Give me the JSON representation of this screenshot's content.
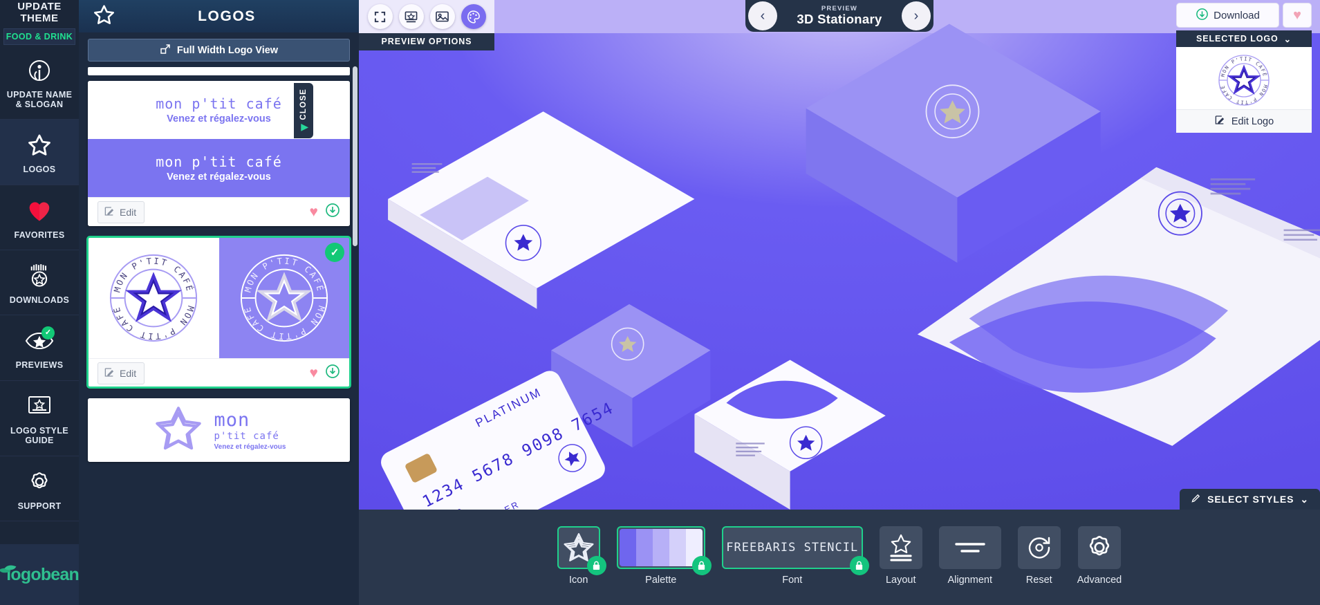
{
  "rail": {
    "top_title": "UPDATE THEME",
    "theme_value": "FOOD & DRINK",
    "items": [
      {
        "label": "UPDATE NAME & SLOGAN",
        "icon": "info-badge-icon"
      },
      {
        "label": "LOGOS",
        "icon": "star-icon"
      },
      {
        "label": "FAVORITES",
        "icon": "heart-icon"
      },
      {
        "label": "DOWNLOADS",
        "icon": "download-star-icon"
      },
      {
        "label": "PREVIEWS",
        "icon": "eye-star-icon"
      },
      {
        "label": "LOGO STYLE GUIDE",
        "icon": "style-guide-icon"
      },
      {
        "label": "SUPPORT",
        "icon": "gear-icon"
      }
    ],
    "brand": "logobean"
  },
  "logos_panel": {
    "title": "LOGOS",
    "full_width_button": "Full Width Logo View",
    "edit_label": "Edit",
    "cards": [
      {
        "type": "wordmark",
        "name": "mon p'tit café",
        "slogan": "Venez et régalez-vous",
        "selected": false
      },
      {
        "type": "emblem",
        "name": "MON P'TIT CAFÉ",
        "selected": true
      },
      {
        "type": "combo",
        "name": "mon",
        "sub": "p'tit café",
        "slogan": "Venez et régalez-vous",
        "selected": false
      }
    ]
  },
  "close_tab": {
    "label": "CLOSE"
  },
  "preview_options": {
    "label": "PREVIEW OPTIONS",
    "buttons": [
      {
        "name": "fullscreen-icon",
        "active": false
      },
      {
        "name": "presentation-icon",
        "active": false
      },
      {
        "name": "image-icon",
        "active": false
      },
      {
        "name": "palette-icon",
        "active": true
      }
    ]
  },
  "preview_nav": {
    "eyebrow": "PREVIEW",
    "title": "3D Stationary",
    "prev": "‹",
    "next": "›"
  },
  "right_panel": {
    "download_label": "Download",
    "favorite_icon": "heart-icon",
    "selected_logo_label": "SELECTED LOGO",
    "edit_logo_label": "Edit Logo"
  },
  "select_styles": {
    "label": "SELECT STYLES"
  },
  "bottom_bar": {
    "tools": [
      {
        "key": "icon",
        "caption": "Icon",
        "locked": true,
        "kind": "star"
      },
      {
        "key": "palette",
        "caption": "Palette",
        "locked": true,
        "kind": "swatches",
        "colors": [
          "#6f66ee",
          "#9b92f4",
          "#b7b0f7",
          "#d4d0fa",
          "#efeeff"
        ]
      },
      {
        "key": "font",
        "caption": "Font",
        "locked": true,
        "kind": "font",
        "font_sample": "FREEBARIS STENCIL"
      },
      {
        "key": "layout",
        "caption": "Layout",
        "locked": false,
        "kind": "layout"
      },
      {
        "key": "alignment",
        "caption": "Alignment",
        "locked": false,
        "kind": "align"
      },
      {
        "key": "reset",
        "caption": "Reset",
        "locked": false,
        "kind": "reset"
      },
      {
        "key": "advanced",
        "caption": "Advanced",
        "locked": false,
        "kind": "gear"
      }
    ]
  },
  "emblem": {
    "top_text": "MON P'TIT CAFÉ",
    "bottom_text": "MON P'TIT CAFÉ"
  }
}
